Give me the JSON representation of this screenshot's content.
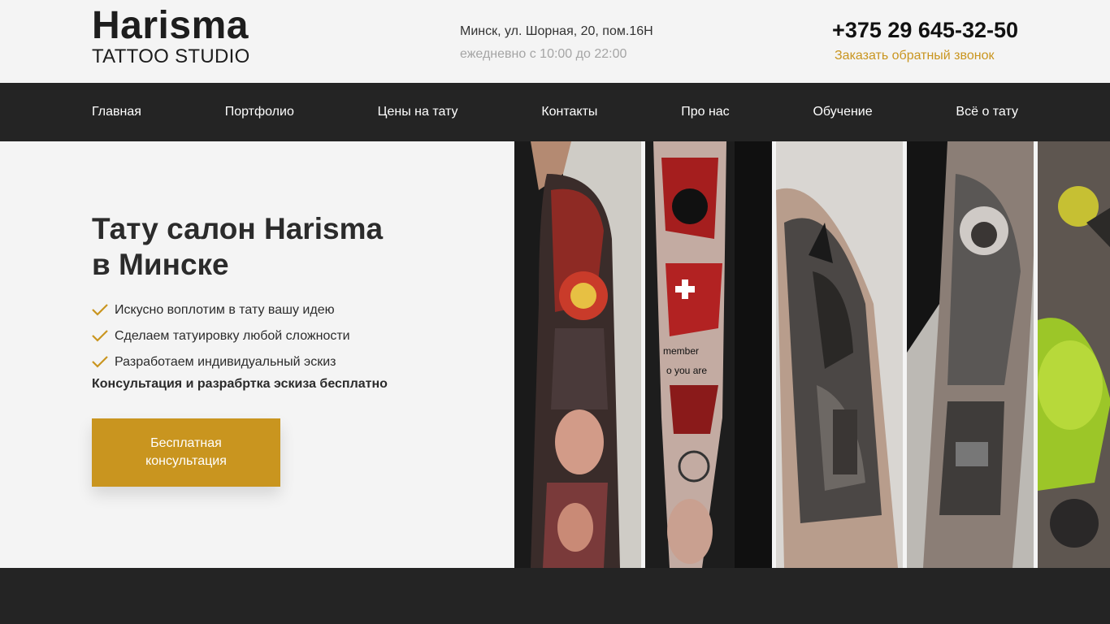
{
  "header": {
    "logo_name": "Harisma",
    "logo_sub": "TATTOO STUDIO",
    "address": "Минск, ул. Шорная, 20, пом.16Н",
    "hours": "ежедневно с 10:00 до 22:00",
    "phone": "+375 29 645-32-50",
    "callback_label": "Заказать обратный звонок"
  },
  "nav": {
    "items": [
      {
        "label": "Главная"
      },
      {
        "label": "Портфолио"
      },
      {
        "label": "Цены на тату"
      },
      {
        "label": "Контакты"
      },
      {
        "label": "Про нас"
      },
      {
        "label": "Обучение"
      },
      {
        "label": "Всё о тату"
      }
    ]
  },
  "hero": {
    "title_line1": "Тату салон Harisma",
    "title_line2": "в Минске",
    "features": [
      "Искусно воплотим в тату вашу идею",
      "Сделаем татуировку любой сложности",
      "Разработаем индивидуальный эскиз"
    ],
    "consult_note": "Консультация и разрабртка эскиза бесплатно",
    "cta_line1": "Бесплатная",
    "cta_line2": "консультация"
  },
  "gallery": {
    "photo_5_text_1": "member",
    "photo_5_text_2": "o you are"
  },
  "colors": {
    "accent": "#c9951f",
    "dark": "#242424",
    "light_bg": "#f4f4f4"
  }
}
